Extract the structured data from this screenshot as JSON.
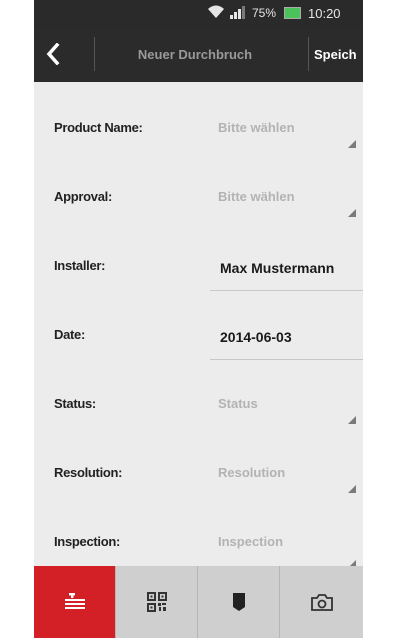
{
  "status_bar": {
    "battery_percent": "75%",
    "time": "10:20",
    "battery_color": "#4cc35a"
  },
  "action_bar": {
    "back_icon": "chevron-left-icon",
    "title": "Neuer Durchbruch",
    "save_label": "Speich"
  },
  "form": {
    "fields": [
      {
        "label": "Product Name:",
        "value": "Bitte wählen",
        "kind": "spinner"
      },
      {
        "label": "Approval:",
        "value": "Bitte wählen",
        "kind": "spinner"
      },
      {
        "label": "Installer:",
        "value": "Max Mustermann",
        "kind": "text"
      },
      {
        "label": "Date:",
        "value": "2014-06-03",
        "kind": "text"
      },
      {
        "label": "Status:",
        "value": "Status",
        "kind": "spinner"
      },
      {
        "label": "Resolution:",
        "value": "Resolution",
        "kind": "spinner"
      },
      {
        "label": "Inspection:",
        "value": "Inspection",
        "kind": "spinner"
      }
    ]
  },
  "bottom_tabs": [
    {
      "icon": "list-icon",
      "active": true
    },
    {
      "icon": "qr-code-icon",
      "active": false
    },
    {
      "icon": "bookmark-icon",
      "active": false
    },
    {
      "icon": "camera-icon",
      "active": false
    }
  ],
  "colors": {
    "accent": "#d32027",
    "actionbar": "#2b2b2b",
    "background": "#ececec"
  }
}
